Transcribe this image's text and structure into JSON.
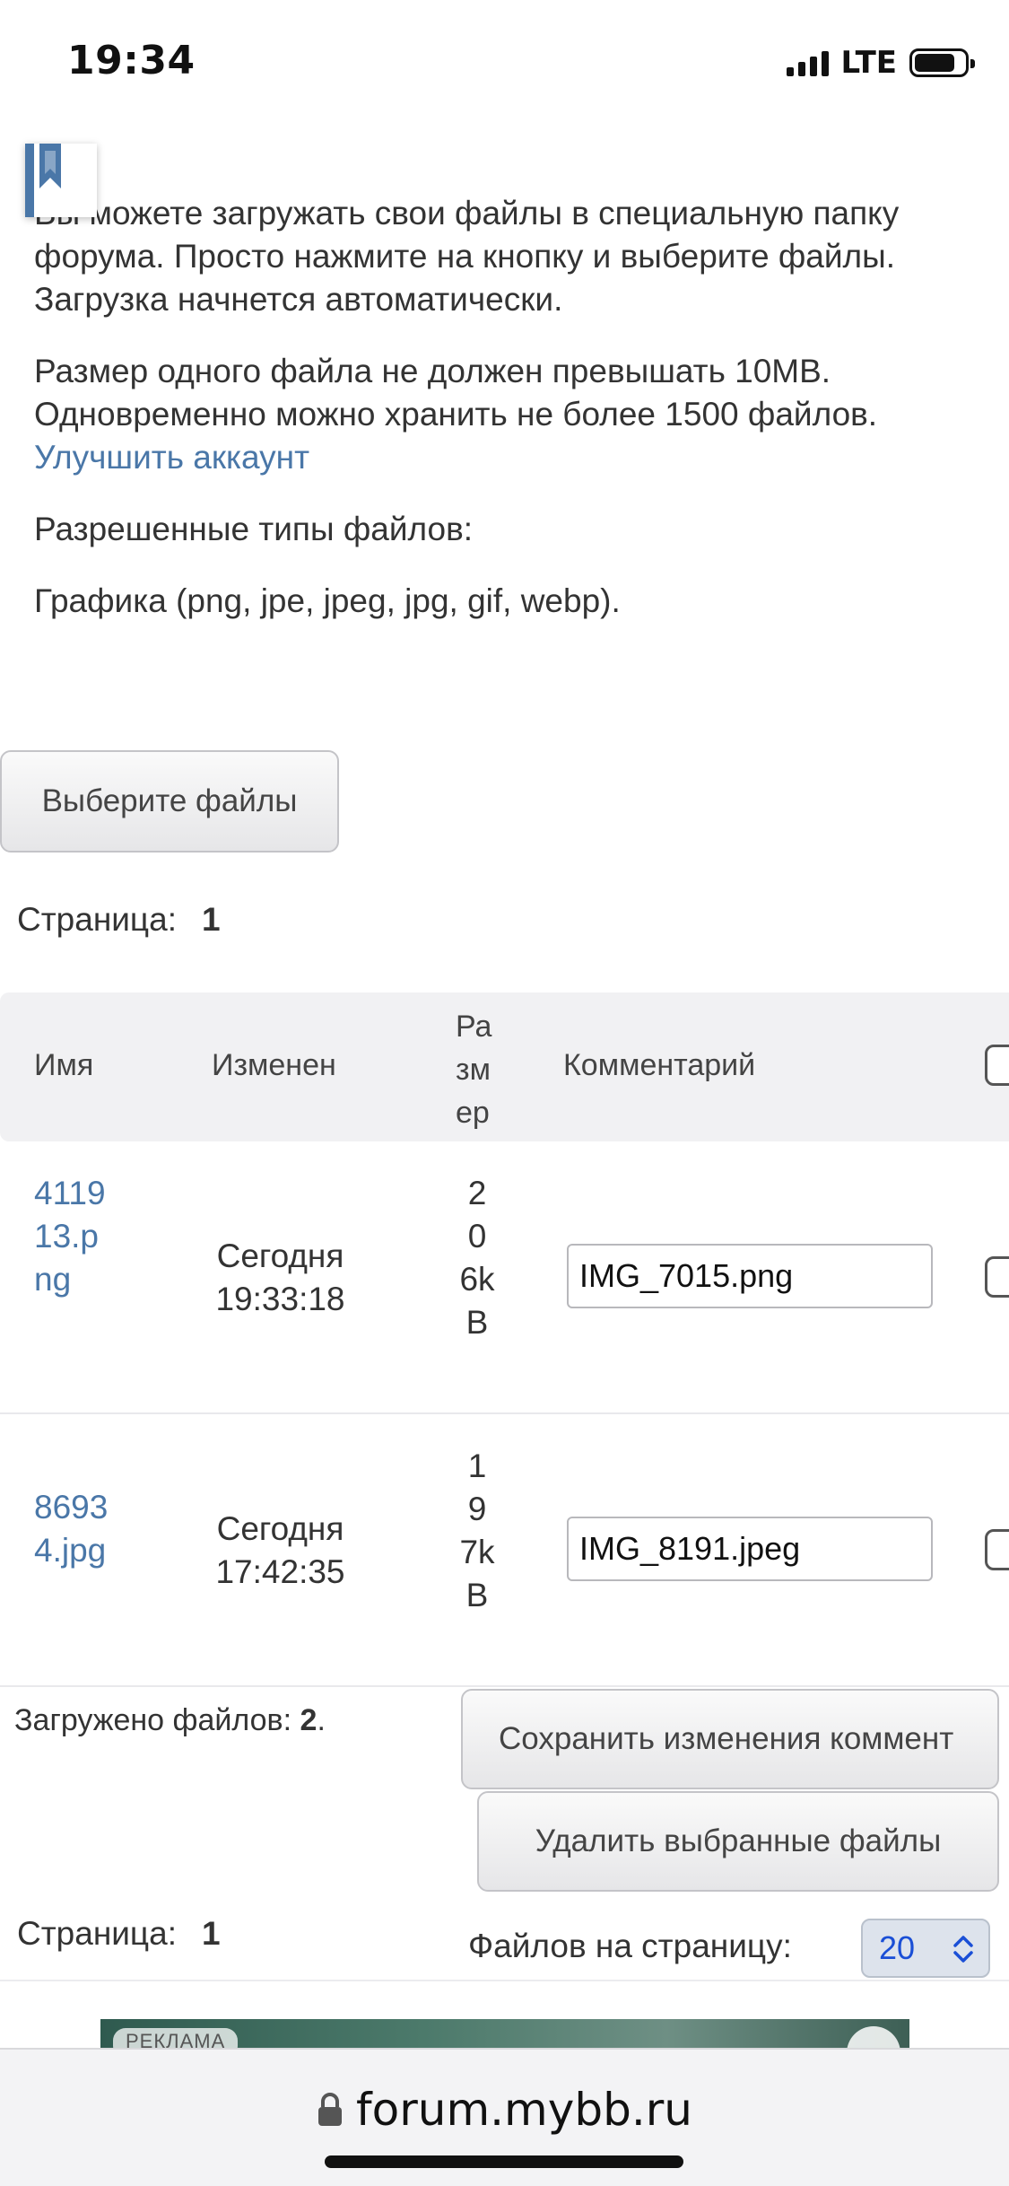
{
  "status_bar": {
    "time": "19:34",
    "network": "LTE"
  },
  "info": {
    "paragraph1": "Вы можете загружать свои файлы в специальную папку форума. Просто нажмите на кнопку и выберите файлы. Загрузка начнется автоматически.",
    "paragraph2_text": "Размер одного файла не должен превышать 10MB. Одновременно можно хранить не более 1500 файлов.",
    "upgrade_link": "Улучшить аккаунт",
    "allowed_label": "Разрешенные типы файлов:",
    "allowed_types": "Графика (png, jpe, jpeg, jpg, gif, webp)."
  },
  "choose_button": "Выберите файлы",
  "pager_top": {
    "label": "Страница:",
    "page": "1"
  },
  "table": {
    "headers": {
      "name": "Имя",
      "modified": "Изменен",
      "size": "Размер",
      "comment": "Комментарий"
    },
    "rows": [
      {
        "name": "411913.png",
        "date_day": "Сегодня",
        "date_time": "19:33:18",
        "size": "206kB",
        "comment": "IMG_7015.png"
      },
      {
        "name": "86934.jpg",
        "date_day": "Сегодня",
        "date_time": "17:42:35",
        "size": "197kB",
        "comment": "IMG_8191.jpeg"
      }
    ]
  },
  "uploaded": {
    "label": "Загружено файлов:",
    "count": "2"
  },
  "save_button": "Сохранить изменения коммент",
  "delete_button": "Удалить выбранные файлы",
  "pager_bottom": {
    "label": "Страница:",
    "page": "1"
  },
  "per_page": {
    "label": "Файлов на страницу:",
    "value": "20"
  },
  "ad": {
    "badge": "РЕКЛАМА"
  },
  "browser": {
    "url": "forum.mybb.ru"
  },
  "colors": {
    "link": "#4a77a8",
    "header_bg": "#f1f1f3",
    "select_text": "#1a4fd6"
  }
}
